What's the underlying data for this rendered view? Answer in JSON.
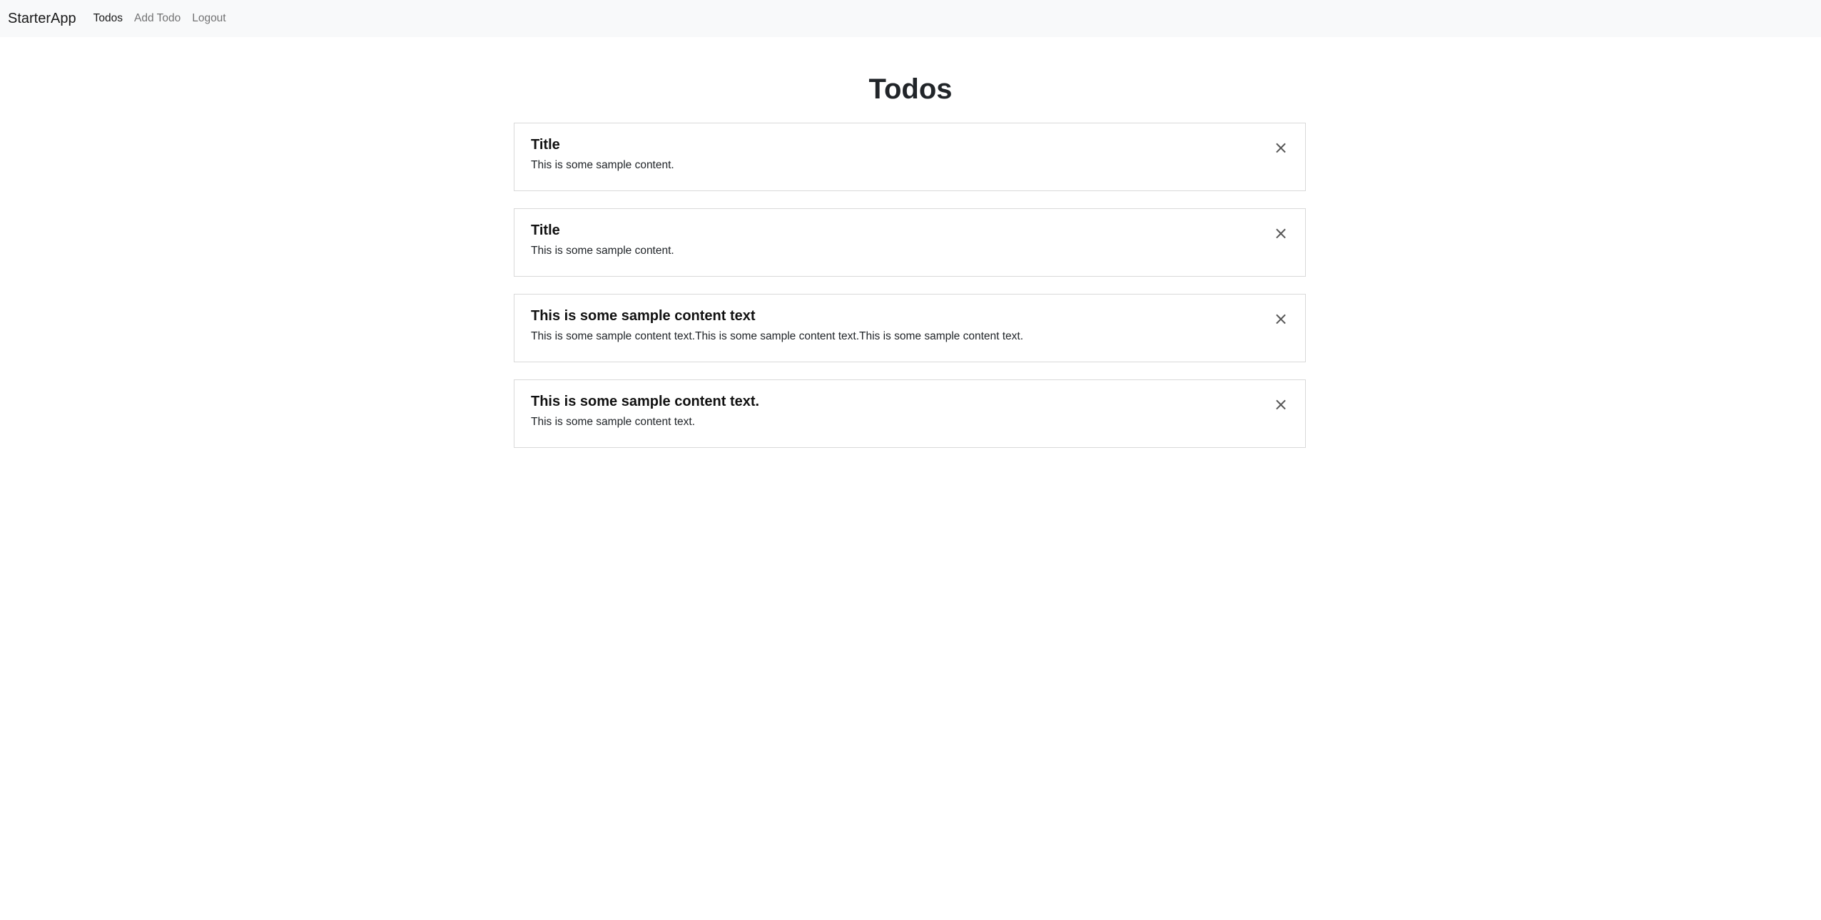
{
  "navbar": {
    "brand": "StarterApp",
    "links": [
      {
        "label": "Todos",
        "active": true
      },
      {
        "label": "Add Todo",
        "active": false
      },
      {
        "label": "Logout",
        "active": false
      }
    ]
  },
  "page": {
    "title": "Todos"
  },
  "todos": [
    {
      "title": "Title",
      "content": "This is some sample content.",
      "close_icon": "close-icon"
    },
    {
      "title": "Title",
      "content": "This is some sample content.",
      "close_icon": "close-icon"
    },
    {
      "title": "This is some sample content text",
      "content": "This is some sample content text.This is some sample content text.This is some sample content text.",
      "close_icon": "close-icon"
    },
    {
      "title": "This is some sample content text.",
      "content": "This is some sample content text.",
      "close_icon": "close-icon"
    }
  ],
  "icons": {
    "close_glyph": "×"
  }
}
